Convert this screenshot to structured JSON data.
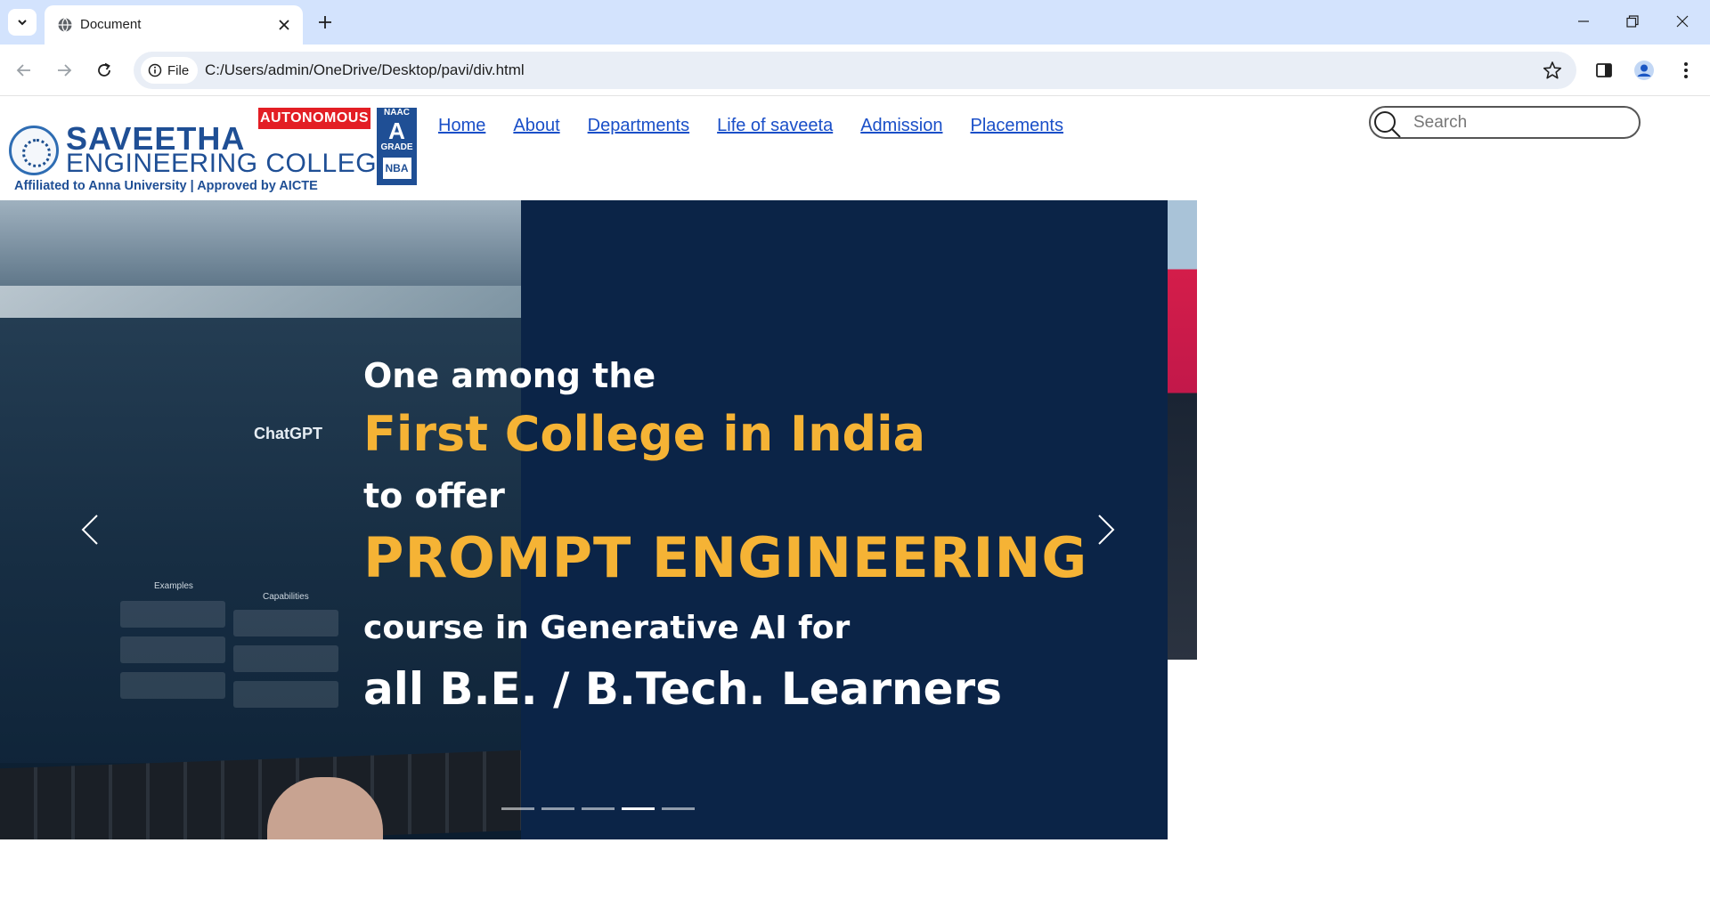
{
  "browser": {
    "tab_title": "Document",
    "address_chip": "File",
    "url": "C:/Users/admin/OneDrive/Desktop/pavi/div.html"
  },
  "logo": {
    "line1": "SAVEETHA",
    "line2": "ENGINEERING COLLEGE",
    "subline": "Affiliated to Anna University | Approved by AICTE",
    "badge": "AUTONOMOUS",
    "naac_top": "NAAC",
    "naac_grade": "A",
    "naac_bottom": "GRADE",
    "nba": "NBA"
  },
  "nav": {
    "items": [
      {
        "label": "Home"
      },
      {
        "label": "About"
      },
      {
        "label": "Departments"
      },
      {
        "label": "Life of saveeta"
      },
      {
        "label": "Admission"
      },
      {
        "label": "Placements"
      }
    ]
  },
  "search": {
    "placeholder": "Search"
  },
  "carousel": {
    "photo_text": "ChatGPT",
    "photo_columns": [
      "Examples",
      "Capabilities"
    ],
    "headline": {
      "line1": "One among the",
      "line2": "First College in India",
      "line3": "to offer",
      "line4": "PROMPT ENGINEERING",
      "line5": "course in Generative AI for",
      "line6": "all B.E. / B.Tech. Learners"
    },
    "slide_count": 5,
    "active_slide": 4
  },
  "colors": {
    "tabstrip": "#d3e3fd",
    "brand_blue": "#1f4f95",
    "autonomous_red": "#e31e24",
    "slide_bg": "#0b2447",
    "headline_accent": "#f5b335",
    "nav_link": "#1a4fc8"
  }
}
